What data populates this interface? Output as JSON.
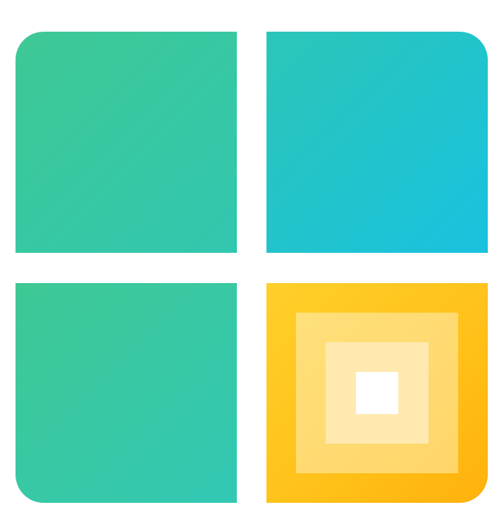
{
  "icon": {
    "name": "grid-dashboard-app-icon",
    "colors": {
      "green": "#3ec894",
      "teal": "#2bc6b8",
      "cyan": "#19c2df",
      "yellow": "#ffc21a",
      "orange": "#ffb10c",
      "light_yellow": "#ffe07a",
      "pale_yellow": "#ffe9ae",
      "white": "#ffffff"
    },
    "tiles": [
      "top-left",
      "top-right",
      "bottom-left",
      "bottom-right"
    ]
  }
}
